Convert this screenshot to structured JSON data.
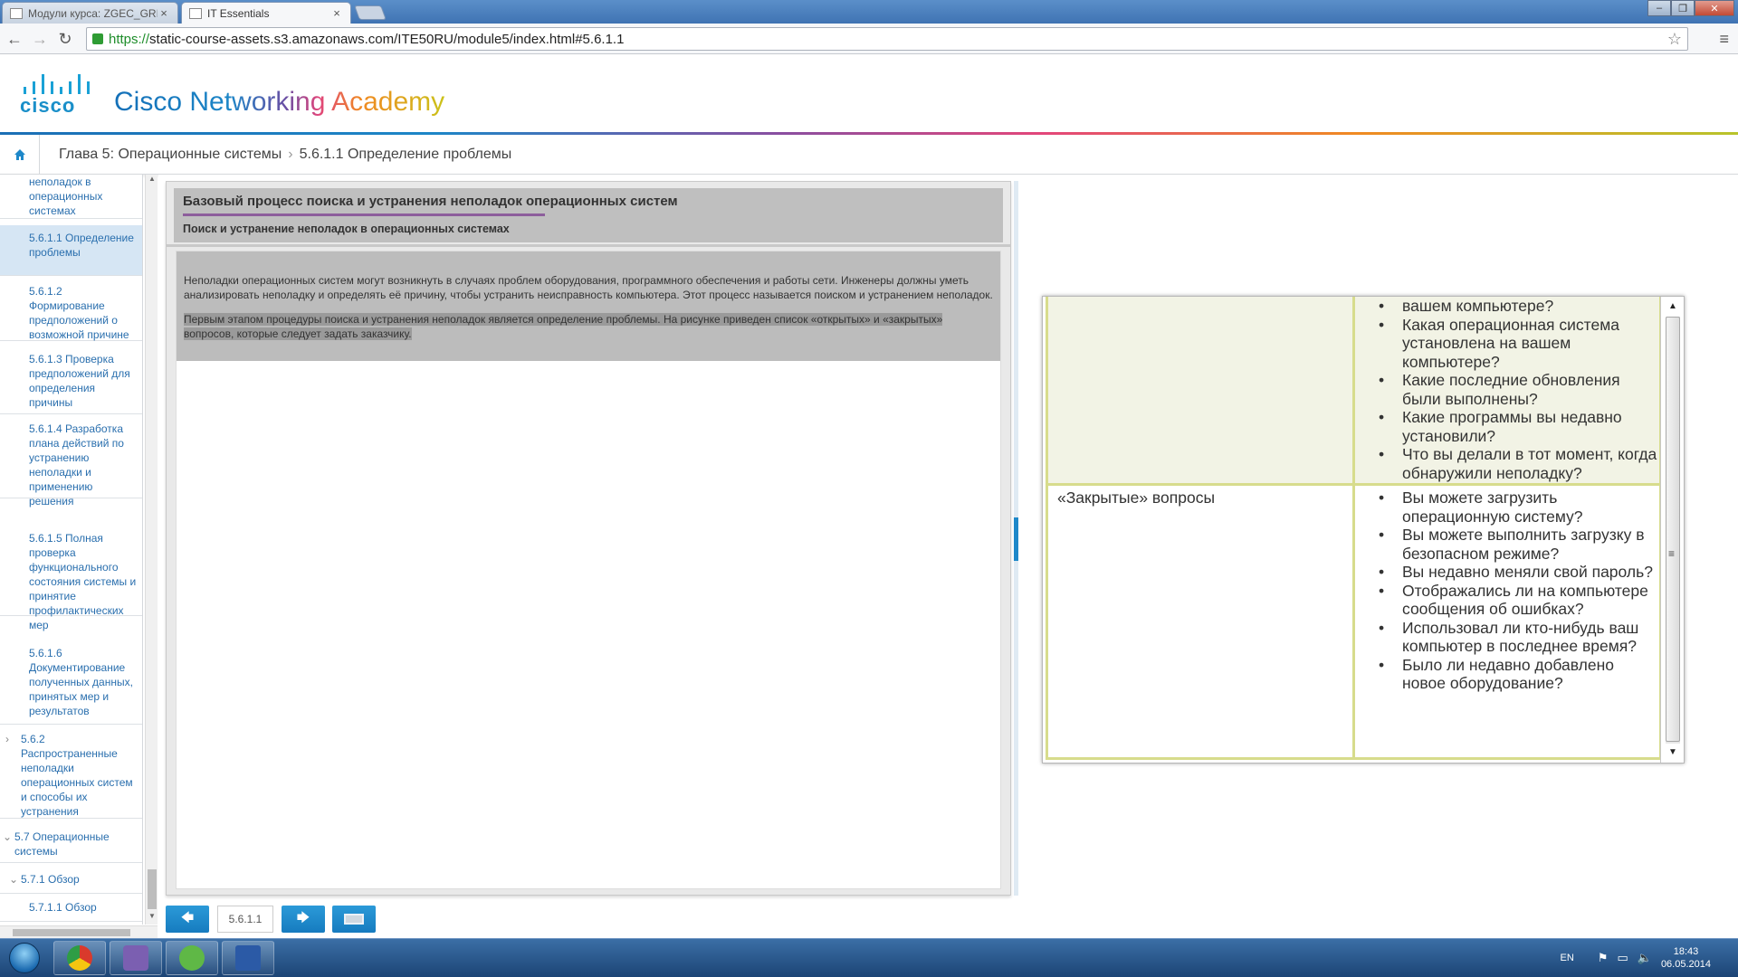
{
  "browser": {
    "tabs": [
      {
        "label": "Модули курса: ZGEC_GRI",
        "active": false
      },
      {
        "label": "IT Essentials",
        "active": true
      }
    ],
    "url_scheme": "https://",
    "url_rest": "static-course-assets.s3.amazonaws.com/ITE50RU/module5/index.html#5.6.1.1"
  },
  "brand": {
    "logo_word": "cisco",
    "title": "Cisco Networking Academy"
  },
  "breadcrumb": {
    "chapter": "Глава 5: Операционные системы",
    "section": "5.6.1.1 Определение проблемы"
  },
  "nav": {
    "items": [
      {
        "label": "неполадок в операционных системах",
        "active": false
      },
      {
        "label": "5.6.1.1 Определение проблемы",
        "active": true
      },
      {
        "label": "5.6.1.2 Формирование предположений о возможной причине",
        "active": false
      },
      {
        "label": "5.6.1.3 Проверка предположений для определения причины",
        "active": false
      },
      {
        "label": "5.6.1.4 Разработка плана действий по устранению неполадки и применению решения",
        "active": false
      },
      {
        "label": "5.6.1.5 Полная проверка функционального состояния системы и принятие профилактических мер",
        "active": false
      },
      {
        "label": "5.6.1.6 Документирование полученных данных, принятых мер и результатов",
        "active": false
      },
      {
        "label": "5.6.2 Распространенные неполадки операционных систем и способы их устранения",
        "active": false
      },
      {
        "label": "5.7 Операционные системы",
        "active": false
      },
      {
        "label": "5.7.1 Обзор",
        "active": false
      },
      {
        "label": "5.7.1.1 Обзор",
        "active": false
      }
    ]
  },
  "content": {
    "heading": "Базовый процесс поиска и устранения неполадок операционных систем",
    "subheading": "Поиск и устранение неполадок в операционных системах",
    "paragraph1": "Неполадки операционных систем могут возникнуть в случаях проблем оборудования, программного обеспечения и работы сети. Инженеры должны уметь анализировать неполадку и определять её причину, чтобы устранить неисправность компьютера. Этот процесс называется поиском и устранением неполадок.",
    "paragraph2": "Первым этапом процедуры поиска и устранения неполадок является определение проблемы. На рисунке приведен список «открытых» и «закрытых» вопросов, которые следует задать заказчику."
  },
  "figure": {
    "open_questions": [
      "вашем компьютере?",
      "Какая операционная система установлена на вашем компьютере?",
      "Какие последние обновления были выполнены?",
      "Какие программы вы недавно установили?",
      "Что вы делали в тот момент, когда обнаружили неполадку?"
    ],
    "closed_label": "«Закрытые» вопросы",
    "closed_questions": [
      "Вы можете загрузить операционную систему?",
      "Вы можете выполнить загрузку в безопасном режиме?",
      "Вы недавно меняли свой пароль?",
      "Отображались ли на компьютере сообщения об ошибках?",
      "Использовал ли кто-нибудь ваш компьютер в последнее время?",
      "Было ли недавно добавлено новое оборудование?"
    ]
  },
  "pager": {
    "page": "5.6.1.1"
  },
  "taskbar": {
    "lang": "EN",
    "time": "18:43",
    "date": "06.05.2014"
  },
  "colors": {
    "accent": "#1e88c9",
    "table_border": "#d7dc8c",
    "open_cell_bg": "#f2f3e5"
  }
}
